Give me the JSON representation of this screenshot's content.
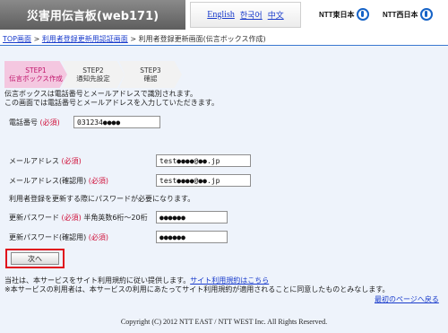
{
  "header": {
    "title": "災害用伝言板(web171)",
    "languages": [
      "English",
      "한국어",
      "中文"
    ],
    "logos": [
      "NTT東日本",
      "NTT西日本"
    ]
  },
  "breadcrumb": {
    "top": "TOP画面",
    "sep": ">",
    "auth": "利用者登録更新用認証画面",
    "current": "利用者登録更新画面(伝言ボックス作成)"
  },
  "steps": [
    {
      "title": "STEP1",
      "label": "伝言ボックス作成"
    },
    {
      "title": "STEP2",
      "label": "通知先設定"
    },
    {
      "title": "STEP3",
      "label": "確認"
    }
  ],
  "intro": {
    "line1": "伝言ボックスは電話番号とメールアドレスで識別されます。",
    "line2": "この画面では電話番号とメールアドレスを入力していただきます。"
  },
  "required": "(必須)",
  "form": {
    "phone_label": "電話番号",
    "phone_value": "031234●●●●",
    "email_label": "メールアドレス",
    "email_value": "test●●●●@●●.jp",
    "email_confirm_label": "メールアドレス(確認用)",
    "email_confirm_value": "test●●●●@●●.jp",
    "password_note": "利用者登録を更新する際にパスワードが必要になります。",
    "password_label": "更新パスワード",
    "password_hint": "半角英数6桁〜20桁",
    "password_value": "●●●●●●",
    "password_confirm_label": "更新パスワード(確認用)",
    "password_confirm_value": "●●●●●●"
  },
  "next_button": "次へ",
  "terms": {
    "line1_prefix": "当社は、本サービスをサイト利用規約に従い提供します。",
    "line1_link": "サイト利用規約はこちら",
    "line2": "※本サービスの利用者は、本サービスの利用にあたってサイト利用規約が適用されることに同意したものとみなします。"
  },
  "back_link": "最初のページへ戻る",
  "copyright": "Copyright (C) 2012 NTT EAST / NTT WEST Inc. All Rights Reserved.",
  "colors": {
    "accent": "#3a78d0",
    "required": "#d0103a",
    "step_active": "#f4c7e0",
    "highlight": "#e0101c"
  }
}
